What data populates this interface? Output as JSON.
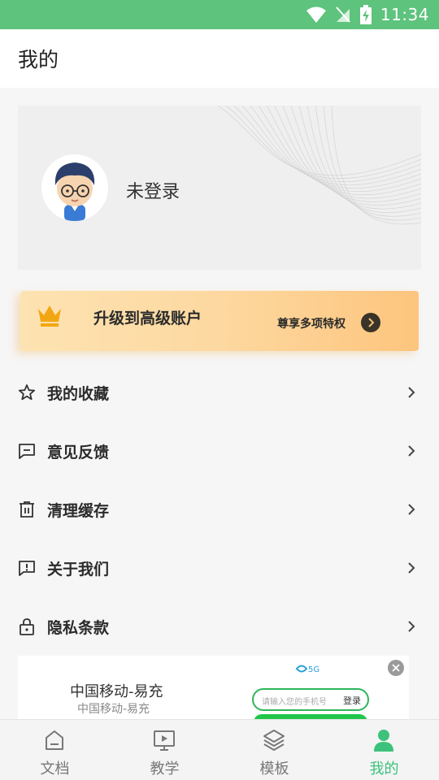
{
  "status_bar": {
    "time": "11:34"
  },
  "header": {
    "title": "我的"
  },
  "profile": {
    "login_text": "未登录"
  },
  "vip": {
    "title": "升级到高级账户",
    "subtitle": "尊享多项特权"
  },
  "menu": [
    {
      "label": "我的收藏",
      "icon": "star-icon"
    },
    {
      "label": "意见反馈",
      "icon": "feedback-icon"
    },
    {
      "label": "清理缓存",
      "icon": "trash-icon"
    },
    {
      "label": "关于我们",
      "icon": "info-icon"
    },
    {
      "label": "隐私条款",
      "icon": "lock-icon"
    }
  ],
  "ad": {
    "title": "中国移动-易充",
    "subtitle": "中国移动-易充",
    "input_placeholder": "请输入您的手机号",
    "login_label": "登录",
    "logo_text": "5G"
  },
  "bottom_nav": [
    {
      "label": "文档",
      "icon": "document-icon",
      "active": false
    },
    {
      "label": "教学",
      "icon": "teaching-icon",
      "active": false
    },
    {
      "label": "模板",
      "icon": "layers-icon",
      "active": false
    },
    {
      "label": "我的",
      "icon": "person-icon",
      "active": true
    }
  ],
  "colors": {
    "accent": "#3cc27a",
    "status_bar": "#5ec37d",
    "vip_gradient": [
      "#fde3b2",
      "#fdc57e"
    ]
  }
}
